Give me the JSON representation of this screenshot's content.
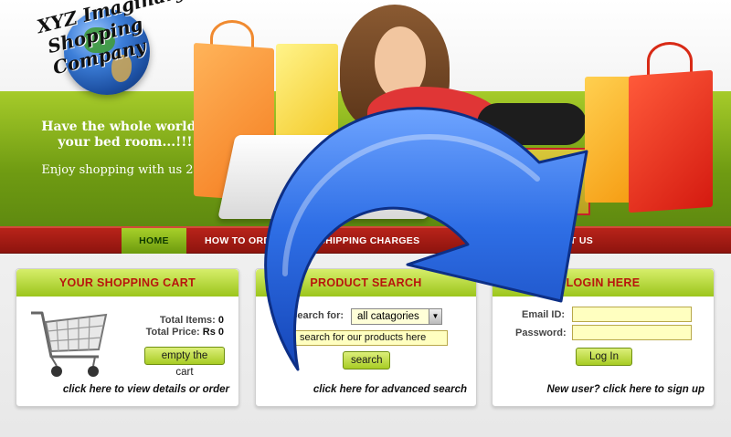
{
  "brand": {
    "line1": "XYZ Imaginary",
    "line2": "Shopping Company"
  },
  "tagline": {
    "headline_1": "Have the whole world in",
    "headline_2": "your bed room...!!!!",
    "subline": "Enjoy shopping with us 24*7"
  },
  "nav": {
    "home": "HOME",
    "how_to_order": "HOW TO ORDER",
    "shipping": "SHIPPING CHARGES",
    "contact": "CONTACT US"
  },
  "cart": {
    "title": "YOUR SHOPPING CART",
    "items_label": "Total Items:",
    "items_value": "0",
    "price_label": "Total Price:",
    "price_value": "Rs 0",
    "empty_button": "empty the cart",
    "footer_link": "click here to view details or order"
  },
  "search": {
    "title": "PRODUCT SEARCH",
    "search_for_label": "Search for:",
    "category_selected": "all catagories",
    "input_value": "search for our products here",
    "button": "search",
    "footer_link": "click here for advanced search"
  },
  "login": {
    "title": "LOGIN HERE",
    "email_label": "Email ID:",
    "password_label": "Password:",
    "button": "Log In",
    "footer_link": "New user? click here to sign up"
  },
  "colors": {
    "nav_red": "#a81a12",
    "panel_header_green": "#b7db3e",
    "heading_red": "#b8150c",
    "input_yellow": "#ffffc0",
    "overlay_arrow_blue": "#2a63d9"
  },
  "overlay": {
    "icon": "curved-redo-arrow"
  }
}
